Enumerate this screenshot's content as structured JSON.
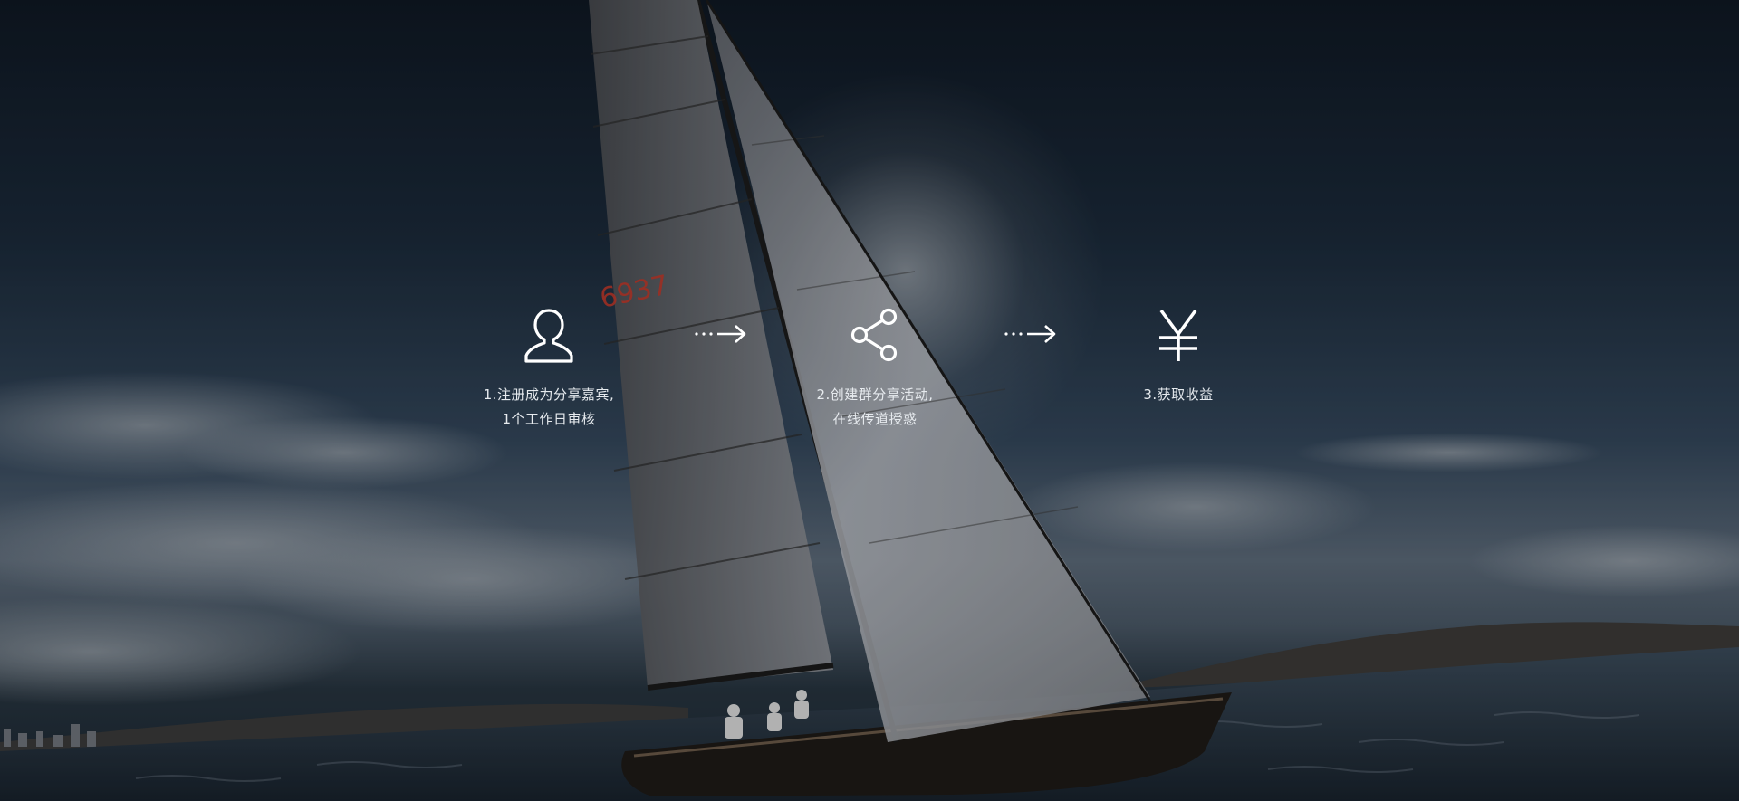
{
  "steps": [
    {
      "icon": "user-icon",
      "line1": "1.注册成为分享嘉宾,",
      "line2": "1个工作日审核"
    },
    {
      "icon": "share-icon",
      "line1": "2.创建群分享活动,",
      "line2": "在线传道授惑"
    },
    {
      "icon": "yen-icon",
      "line1": "3.获取收益",
      "line2": ""
    }
  ],
  "sail_number": "6937",
  "colors": {
    "text": "#e6eaee",
    "icon": "#ffffff",
    "sky_top": "#0f1823",
    "sea": "#1b2631"
  }
}
